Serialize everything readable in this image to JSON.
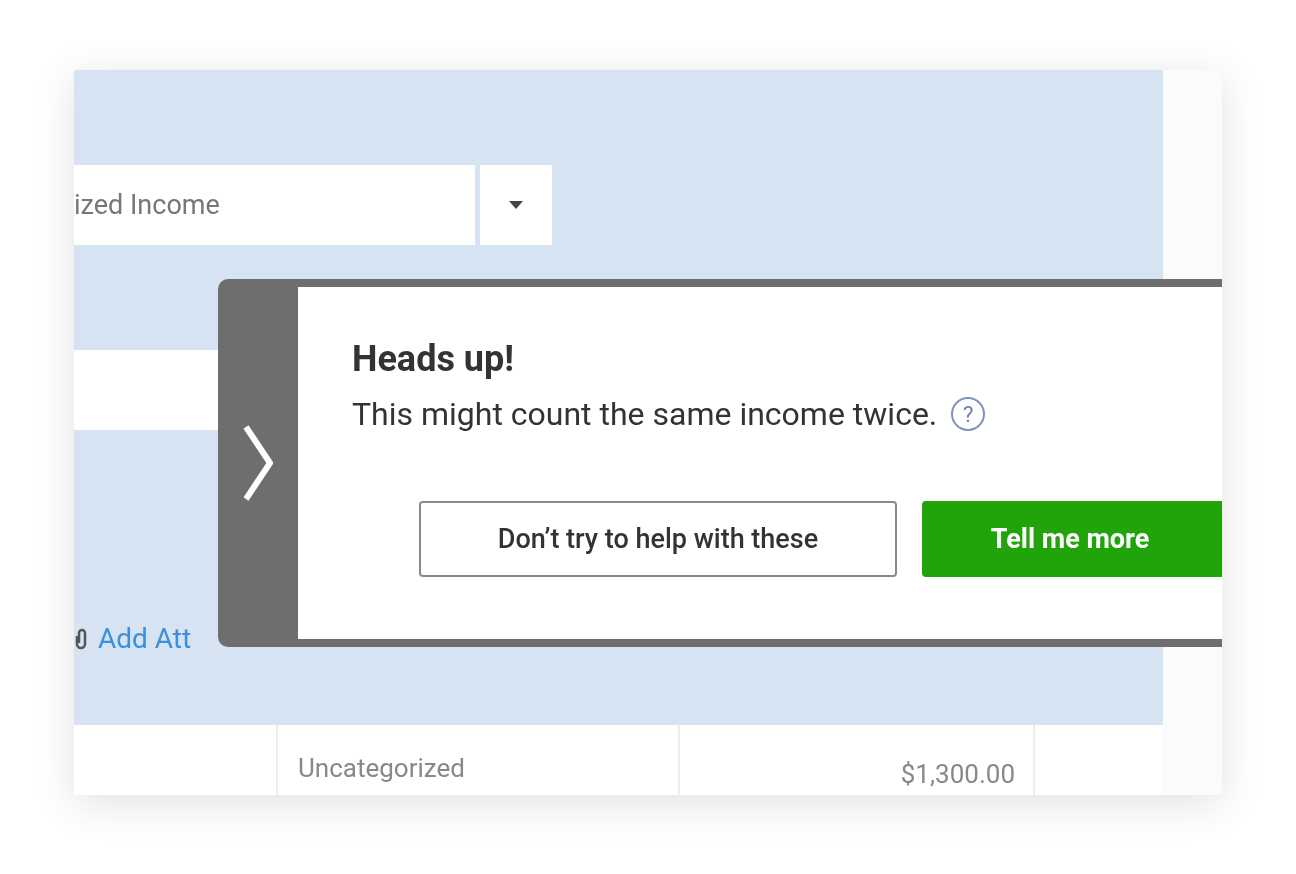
{
  "background": {
    "category_field": {
      "value": "ized Income"
    },
    "attachment_link": "Add Att",
    "table_row": {
      "category": "Uncategorized",
      "amount": "$1,300.00"
    }
  },
  "popup": {
    "title": "Heads up!",
    "message": "This might count the same income twice.",
    "help_icon": "?",
    "buttons": [
      {
        "label": "Don’t try to help with these",
        "kind": "secondary"
      },
      {
        "label": "Tell me more",
        "kind": "primary"
      }
    ]
  }
}
